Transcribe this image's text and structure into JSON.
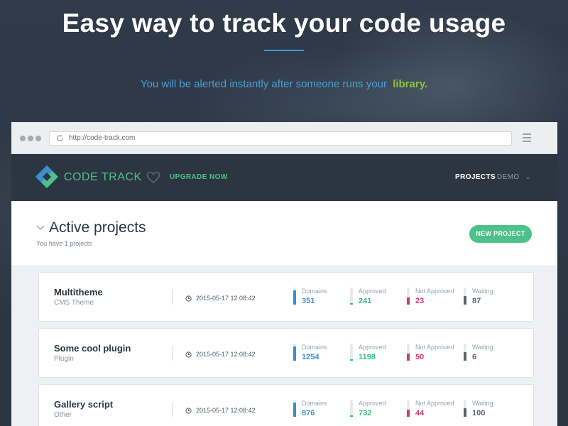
{
  "hero": {
    "title": "Easy way to track your code usage",
    "subtitle": "You will be alerted instantly after someone runs your",
    "subtitle_accent": "library."
  },
  "browser": {
    "url": "http://code-track.com"
  },
  "app": {
    "logo_text": "CODE TRACK",
    "upgrade_label": "UPGRADE NOW",
    "nav": {
      "projects_label": "PROJECTS",
      "demo_label": "DEMO"
    }
  },
  "section": {
    "title": "Active projects",
    "subtitle": "You have 1 projects",
    "new_project_label": "NEW PROJECT"
  },
  "stat_labels": {
    "domains": "Domains",
    "approved": "Approved",
    "not_approved": "Not Approved",
    "waiting": "Waiting"
  },
  "colors": {
    "accent_green": "#4cc18a",
    "lime": "#8cc43f",
    "domains": "#3b8fd0",
    "approved": "#2ec27e",
    "not_approved": "#d23a67",
    "waiting": "#5a636c"
  },
  "projects": [
    {
      "name": "Multitheme",
      "type": "CMS Theme",
      "date": "2015-05-17 12:08:42",
      "domains": "351",
      "approved": "241",
      "not_approved": "23",
      "waiting": "87",
      "levels": {
        "domains": 0.85,
        "approved": 0.1,
        "not_approved": 0.4,
        "waiting": 0.5
      }
    },
    {
      "name": "Some cool plugin",
      "type": "Plugin",
      "date": "2015-05-17 12:08:42",
      "domains": "1254",
      "approved": "1198",
      "not_approved": "50",
      "waiting": "6",
      "levels": {
        "domains": 0.85,
        "approved": 0.1,
        "not_approved": 0.4,
        "waiting": 0.5
      }
    },
    {
      "name": "Gallery script",
      "type": "Other",
      "date": "2015-05-17 12:08:42",
      "domains": "876",
      "approved": "732",
      "not_approved": "44",
      "waiting": "100",
      "levels": {
        "domains": 0.85,
        "approved": 0.1,
        "not_approved": 0.4,
        "waiting": 0.5
      }
    }
  ]
}
